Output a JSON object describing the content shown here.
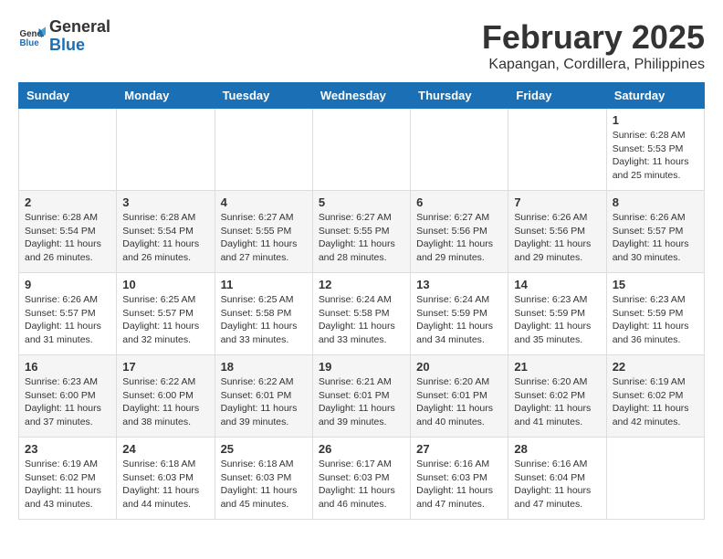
{
  "logo": {
    "text_general": "General",
    "text_blue": "Blue"
  },
  "header": {
    "month": "February 2025",
    "location": "Kapangan, Cordillera, Philippines"
  },
  "weekdays": [
    "Sunday",
    "Monday",
    "Tuesday",
    "Wednesday",
    "Thursday",
    "Friday",
    "Saturday"
  ],
  "weeks": [
    [
      {
        "day": "",
        "info": ""
      },
      {
        "day": "",
        "info": ""
      },
      {
        "day": "",
        "info": ""
      },
      {
        "day": "",
        "info": ""
      },
      {
        "day": "",
        "info": ""
      },
      {
        "day": "",
        "info": ""
      },
      {
        "day": "1",
        "info": "Sunrise: 6:28 AM\nSunset: 5:53 PM\nDaylight: 11 hours\nand 25 minutes."
      }
    ],
    [
      {
        "day": "2",
        "info": "Sunrise: 6:28 AM\nSunset: 5:54 PM\nDaylight: 11 hours\nand 26 minutes."
      },
      {
        "day": "3",
        "info": "Sunrise: 6:28 AM\nSunset: 5:54 PM\nDaylight: 11 hours\nand 26 minutes."
      },
      {
        "day": "4",
        "info": "Sunrise: 6:27 AM\nSunset: 5:55 PM\nDaylight: 11 hours\nand 27 minutes."
      },
      {
        "day": "5",
        "info": "Sunrise: 6:27 AM\nSunset: 5:55 PM\nDaylight: 11 hours\nand 28 minutes."
      },
      {
        "day": "6",
        "info": "Sunrise: 6:27 AM\nSunset: 5:56 PM\nDaylight: 11 hours\nand 29 minutes."
      },
      {
        "day": "7",
        "info": "Sunrise: 6:26 AM\nSunset: 5:56 PM\nDaylight: 11 hours\nand 29 minutes."
      },
      {
        "day": "8",
        "info": "Sunrise: 6:26 AM\nSunset: 5:57 PM\nDaylight: 11 hours\nand 30 minutes."
      }
    ],
    [
      {
        "day": "9",
        "info": "Sunrise: 6:26 AM\nSunset: 5:57 PM\nDaylight: 11 hours\nand 31 minutes."
      },
      {
        "day": "10",
        "info": "Sunrise: 6:25 AM\nSunset: 5:57 PM\nDaylight: 11 hours\nand 32 minutes."
      },
      {
        "day": "11",
        "info": "Sunrise: 6:25 AM\nSunset: 5:58 PM\nDaylight: 11 hours\nand 33 minutes."
      },
      {
        "day": "12",
        "info": "Sunrise: 6:24 AM\nSunset: 5:58 PM\nDaylight: 11 hours\nand 33 minutes."
      },
      {
        "day": "13",
        "info": "Sunrise: 6:24 AM\nSunset: 5:59 PM\nDaylight: 11 hours\nand 34 minutes."
      },
      {
        "day": "14",
        "info": "Sunrise: 6:23 AM\nSunset: 5:59 PM\nDaylight: 11 hours\nand 35 minutes."
      },
      {
        "day": "15",
        "info": "Sunrise: 6:23 AM\nSunset: 5:59 PM\nDaylight: 11 hours\nand 36 minutes."
      }
    ],
    [
      {
        "day": "16",
        "info": "Sunrise: 6:23 AM\nSunset: 6:00 PM\nDaylight: 11 hours\nand 37 minutes."
      },
      {
        "day": "17",
        "info": "Sunrise: 6:22 AM\nSunset: 6:00 PM\nDaylight: 11 hours\nand 38 minutes."
      },
      {
        "day": "18",
        "info": "Sunrise: 6:22 AM\nSunset: 6:01 PM\nDaylight: 11 hours\nand 39 minutes."
      },
      {
        "day": "19",
        "info": "Sunrise: 6:21 AM\nSunset: 6:01 PM\nDaylight: 11 hours\nand 39 minutes."
      },
      {
        "day": "20",
        "info": "Sunrise: 6:20 AM\nSunset: 6:01 PM\nDaylight: 11 hours\nand 40 minutes."
      },
      {
        "day": "21",
        "info": "Sunrise: 6:20 AM\nSunset: 6:02 PM\nDaylight: 11 hours\nand 41 minutes."
      },
      {
        "day": "22",
        "info": "Sunrise: 6:19 AM\nSunset: 6:02 PM\nDaylight: 11 hours\nand 42 minutes."
      }
    ],
    [
      {
        "day": "23",
        "info": "Sunrise: 6:19 AM\nSunset: 6:02 PM\nDaylight: 11 hours\nand 43 minutes."
      },
      {
        "day": "24",
        "info": "Sunrise: 6:18 AM\nSunset: 6:03 PM\nDaylight: 11 hours\nand 44 minutes."
      },
      {
        "day": "25",
        "info": "Sunrise: 6:18 AM\nSunset: 6:03 PM\nDaylight: 11 hours\nand 45 minutes."
      },
      {
        "day": "26",
        "info": "Sunrise: 6:17 AM\nSunset: 6:03 PM\nDaylight: 11 hours\nand 46 minutes."
      },
      {
        "day": "27",
        "info": "Sunrise: 6:16 AM\nSunset: 6:03 PM\nDaylight: 11 hours\nand 47 minutes."
      },
      {
        "day": "28",
        "info": "Sunrise: 6:16 AM\nSunset: 6:04 PM\nDaylight: 11 hours\nand 47 minutes."
      },
      {
        "day": "",
        "info": ""
      }
    ]
  ]
}
